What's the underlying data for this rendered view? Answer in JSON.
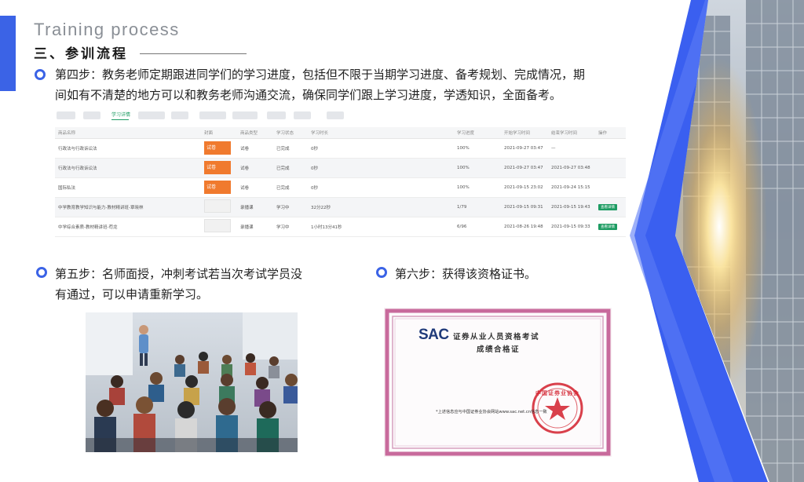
{
  "header": {
    "en_title": "Training process",
    "cn_title": "三、参训流程"
  },
  "step4": {
    "text_line1": "第四步：教务老师定期跟进同学们的学习进度，包括但不限于当期学习进度、备考规划、完成情况，期",
    "text_line2": "间如有不清楚的地方可以和教务老师沟通交流，确保同学们跟上学习进度，学透知识，全面备考。"
  },
  "study_table": {
    "active_tab": "学习详情",
    "columns": [
      "商品名称",
      "封面",
      "商品类型",
      "学习状态",
      "学习时长",
      "学习进度",
      "开始学习时间",
      "结束学习时间",
      "操作"
    ],
    "rows": [
      {
        "name": "行政法与行政诉讼法",
        "cover": "试卷",
        "type": "试卷",
        "status": "已完成",
        "duration": "0秒",
        "progress": "100%",
        "start": "2021-09-27 03:47",
        "end": "—",
        "action": ""
      },
      {
        "name": "行政法与行政诉讼法",
        "cover": "试卷",
        "type": "试卷",
        "status": "已完成",
        "duration": "0秒",
        "progress": "100%",
        "start": "2021-09-27 03:47",
        "end": "2021-09-27 03:48",
        "action": ""
      },
      {
        "name": "国际私法",
        "cover": "试卷",
        "type": "试卷",
        "status": "已完成",
        "duration": "0秒",
        "progress": "100%",
        "start": "2021-09-15 23:02",
        "end": "2021-09-24 15:15",
        "action": ""
      },
      {
        "name": "中学教育教学知识与能力-教材精讲班-覃晓林",
        "cover": "",
        "type": "录播课",
        "status": "学习中",
        "duration": "32分22秒",
        "progress": "1/79",
        "start": "2021-09-15 09:31",
        "end": "2021-09-15 19:43",
        "action": "查看详情"
      },
      {
        "name": "中学综合素质-教材精讲班-苟龙",
        "cover": "",
        "type": "录播课",
        "status": "学习中",
        "duration": "1小时13分41秒",
        "progress": "6/96",
        "start": "2021-08-26 19:48",
        "end": "2021-09-15 09:33",
        "action": "查看详情"
      }
    ]
  },
  "step5": {
    "text_line1": "第五步：名师面授，冲刺考试若当次考试学员没",
    "text_line2": "有通过，可以申请重新学习。"
  },
  "step6": {
    "text": "第六步：获得该资格证书。"
  },
  "certificate": {
    "logo": "SAC",
    "title_line1": "证券从业人员资格考试",
    "title_line2": "成绩合格证",
    "footnote": "*上述信息应与中国证券业协会网站www.sac.net.cn信息一致",
    "seal_text": "中国证券业协会"
  },
  "colors": {
    "accent_blue": "#3b63e6",
    "table_green": "#1e9c63",
    "cover_orange": "#f07a2e",
    "cert_border": "#c86a9c",
    "seal_red": "#d21e2b"
  }
}
